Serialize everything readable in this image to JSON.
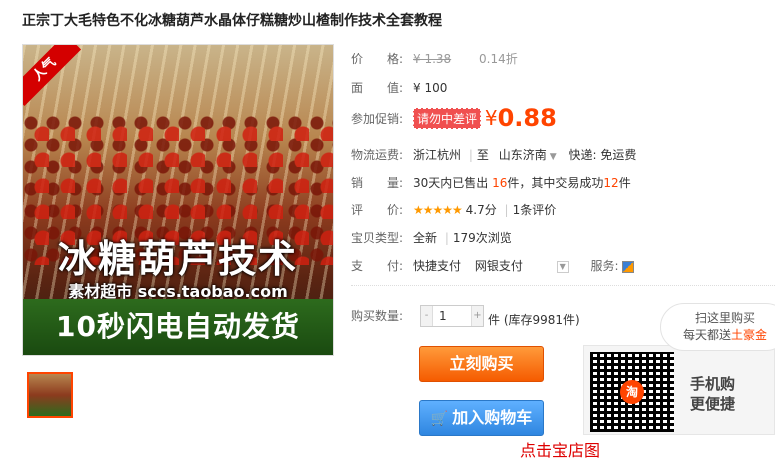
{
  "title": "正宗丁大毛特色不化冰糖葫芦水晶体仔糕糖炒山楂制作技术全套教程",
  "image": {
    "ribbon": "人气",
    "headline": "冰糖葫芦技术",
    "subline": "素材超市 sccs.taobao.com",
    "banner": "10秒闪电自动发货"
  },
  "details": {
    "price_label": "价　　格:",
    "price_original": "¥ 1.38",
    "discount": "0.14折",
    "face_label": "面　　值:",
    "face_value": "¥ 100",
    "promo_label": "参加促销:",
    "promo_tag": "请勿中差评",
    "promo_yen": "¥",
    "promo_price": "0.88",
    "shipping_label": "物流运费:",
    "ship_from": "浙江杭州",
    "ship_to_prefix": "至",
    "ship_to": "山东济南",
    "express": "快递: 免运费",
    "sales_label": "销　　量:",
    "sales_prefix": "30天内已售出",
    "sales_sold": "16",
    "sales_mid": "件，其中交易成功",
    "sales_success": "12",
    "sales_suffix": "件",
    "rating_label": "评　　价:",
    "rating_stars": "★★★★★",
    "rating_score": "4.7分",
    "rating_reviews": "1条评价",
    "type_label": "宝贝类型:",
    "type_value": "全新",
    "views": "179次浏览",
    "pay_label": "支　　付:",
    "pay_quick": "快捷支付",
    "pay_bank": "网银支付",
    "service_label": "服务:"
  },
  "purchase": {
    "qty_label": "购买数量:",
    "qty_value": "1",
    "stock_text": "件 (库存9981件)",
    "buy_button": "立刻购买",
    "cart_button": "加入购物车",
    "cart_icon": "cart-icon"
  },
  "qr": {
    "logo": "淘",
    "text_line1": "手机购",
    "text_line2": "更便捷"
  },
  "bubble": {
    "line1": "扫这里购买",
    "line2_prefix": "每天都送",
    "line2_gold": "土豪金"
  },
  "cutoff_text": "点击宝店图"
}
